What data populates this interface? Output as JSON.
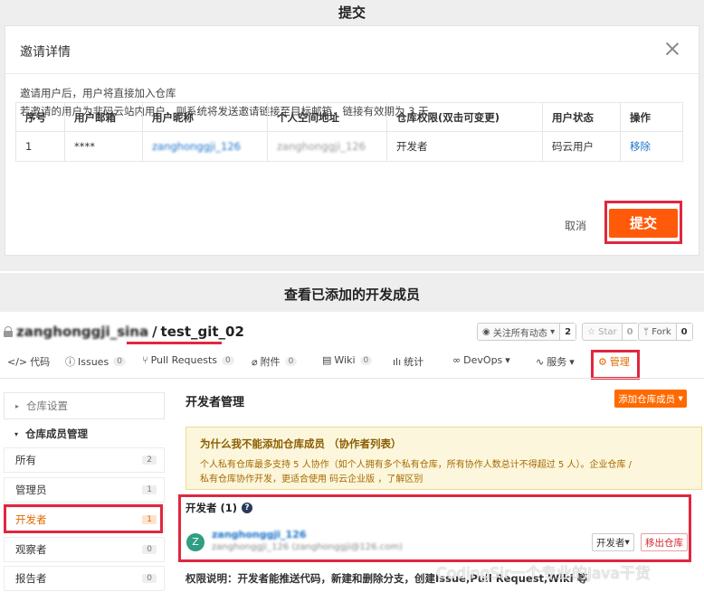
{
  "section_top": {
    "title": "提交"
  },
  "modal": {
    "title": "邀请详情",
    "note_line1": "邀请用户后，用户将直接加入仓库",
    "note_line2": "若邀请的用户为非码云站内用户，则系统将发送邀请链接至目标邮箱，链接有效期为 3 天",
    "columns": [
      "序号",
      "用户邮箱",
      "用户昵称",
      "个人空间地址",
      "仓库权限(双击可变更)",
      "用户状态",
      "操作"
    ],
    "row": {
      "index": "1",
      "email": "****",
      "nickname": "zanghonggji_126",
      "space": "zanghonggji_126",
      "permission": "开发者",
      "status": "码云用户",
      "action": "移除"
    },
    "cancel_label": "取消",
    "submit_label": "提交"
  },
  "section_bottom": {
    "title": "查看已添加的开发成员"
  },
  "repo": {
    "owner": "zanghonggji_sina",
    "separator": " / ",
    "name": "test_git_02",
    "watch_label": "关注所有动态",
    "watch_count": "2",
    "star_label": "Star",
    "star_count": "0",
    "fork_label": "Fork",
    "fork_count": "0"
  },
  "tabs": [
    {
      "label": "代码"
    },
    {
      "label": "Issues",
      "count": "0"
    },
    {
      "label": "Pull Requests",
      "count": "0"
    },
    {
      "label": "附件",
      "count": "0"
    },
    {
      "label": "Wiki",
      "count": "0"
    },
    {
      "label": "统计"
    },
    {
      "label": "DevOps"
    },
    {
      "label": "服务"
    },
    {
      "label": "管理"
    }
  ],
  "sidebar": {
    "settings_label": "仓库设置",
    "members_label": "仓库成员管理",
    "items": [
      {
        "label": "所有",
        "count": "2"
      },
      {
        "label": "管理员",
        "count": "1"
      },
      {
        "label": "开发者",
        "count": "1"
      },
      {
        "label": "观察者",
        "count": "0"
      },
      {
        "label": "报告者",
        "count": "0"
      }
    ]
  },
  "main": {
    "title": "开发者管理",
    "add_button": "添加仓库成员",
    "warning_title": "为什么我不能添加仓库成员 （协作者列表）",
    "warning_line1": "个人私有仓库最多支持 5 人协作（如个人拥有多个私有仓库，所有协作人数总计不得超过 5 人）。企业仓库 /",
    "warning_line2": "私有仓库协作开发，更适合使用 码云企业版 ，了解区别",
    "dev_title": "开发者 (1)",
    "member": {
      "avatar_letter": "Z",
      "name": "zanghonggji_126",
      "sub": "zanghonggji_126 (zanghonggji@126.com)",
      "role_label": "开发者",
      "remove_label": "移出仓库"
    },
    "perm_note": "权限说明：开发者能推送代码，新建和删除分支，创建Issue,Pull Request,Wiki 等"
  },
  "watermark": "CodingSir一个专业的Java干货",
  "colors": {
    "accent_orange": "#ff5a0a",
    "highlight_red": "#e0273e",
    "link_blue": "#1a73c8"
  }
}
